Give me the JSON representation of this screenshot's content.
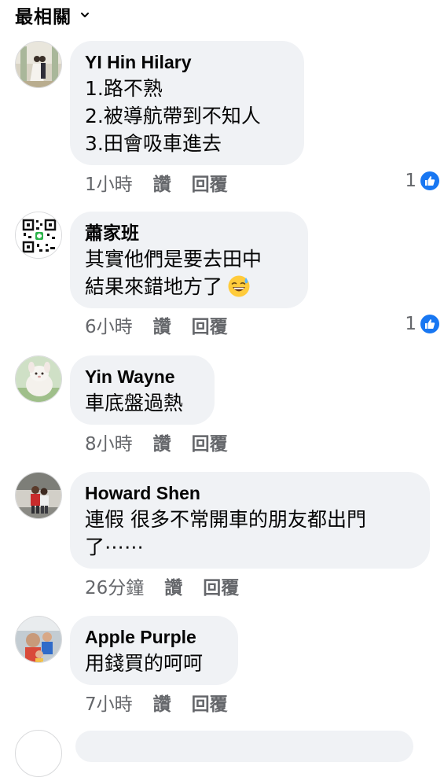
{
  "sort": {
    "label": "最相關"
  },
  "comments": [
    {
      "author": "YI Hin Hilary",
      "lines": [
        "1.路不熟",
        "2.被導航帶到不知人",
        "3.田會吸車進去"
      ],
      "time": "1小時",
      "like_label": "讚",
      "reply_label": "回覆",
      "reactions": "1"
    },
    {
      "author": "蕭家班",
      "lines": [
        "其實他們是要去田中",
        "結果來錯地方了"
      ],
      "time": "6小時",
      "like_label": "讚",
      "reply_label": "回覆",
      "reactions": "1"
    },
    {
      "author": "Yin Wayne",
      "lines": [
        "車底盤過熱"
      ],
      "time": "8小時",
      "like_label": "讚",
      "reply_label": "回覆"
    },
    {
      "author": "Howard Shen",
      "lines": [
        "連假 很多不常開車的朋友都出門",
        "了⋯⋯"
      ],
      "time": "26分鐘",
      "like_label": "讚",
      "reply_label": "回覆"
    },
    {
      "author": "Apple Purple",
      "lines": [
        "用錢買的呵呵"
      ],
      "time": "7小時",
      "like_label": "讚",
      "reply_label": "回覆"
    }
  ],
  "icons": {
    "sort_chevron": "chevron-down-icon",
    "reaction": "thumbs-up-icon",
    "emoji": "grinning-sweat-emoji"
  },
  "colors": {
    "bubble": "#f0f2f5",
    "secondary_text": "#65676b",
    "like_blue": "#1877f2"
  }
}
